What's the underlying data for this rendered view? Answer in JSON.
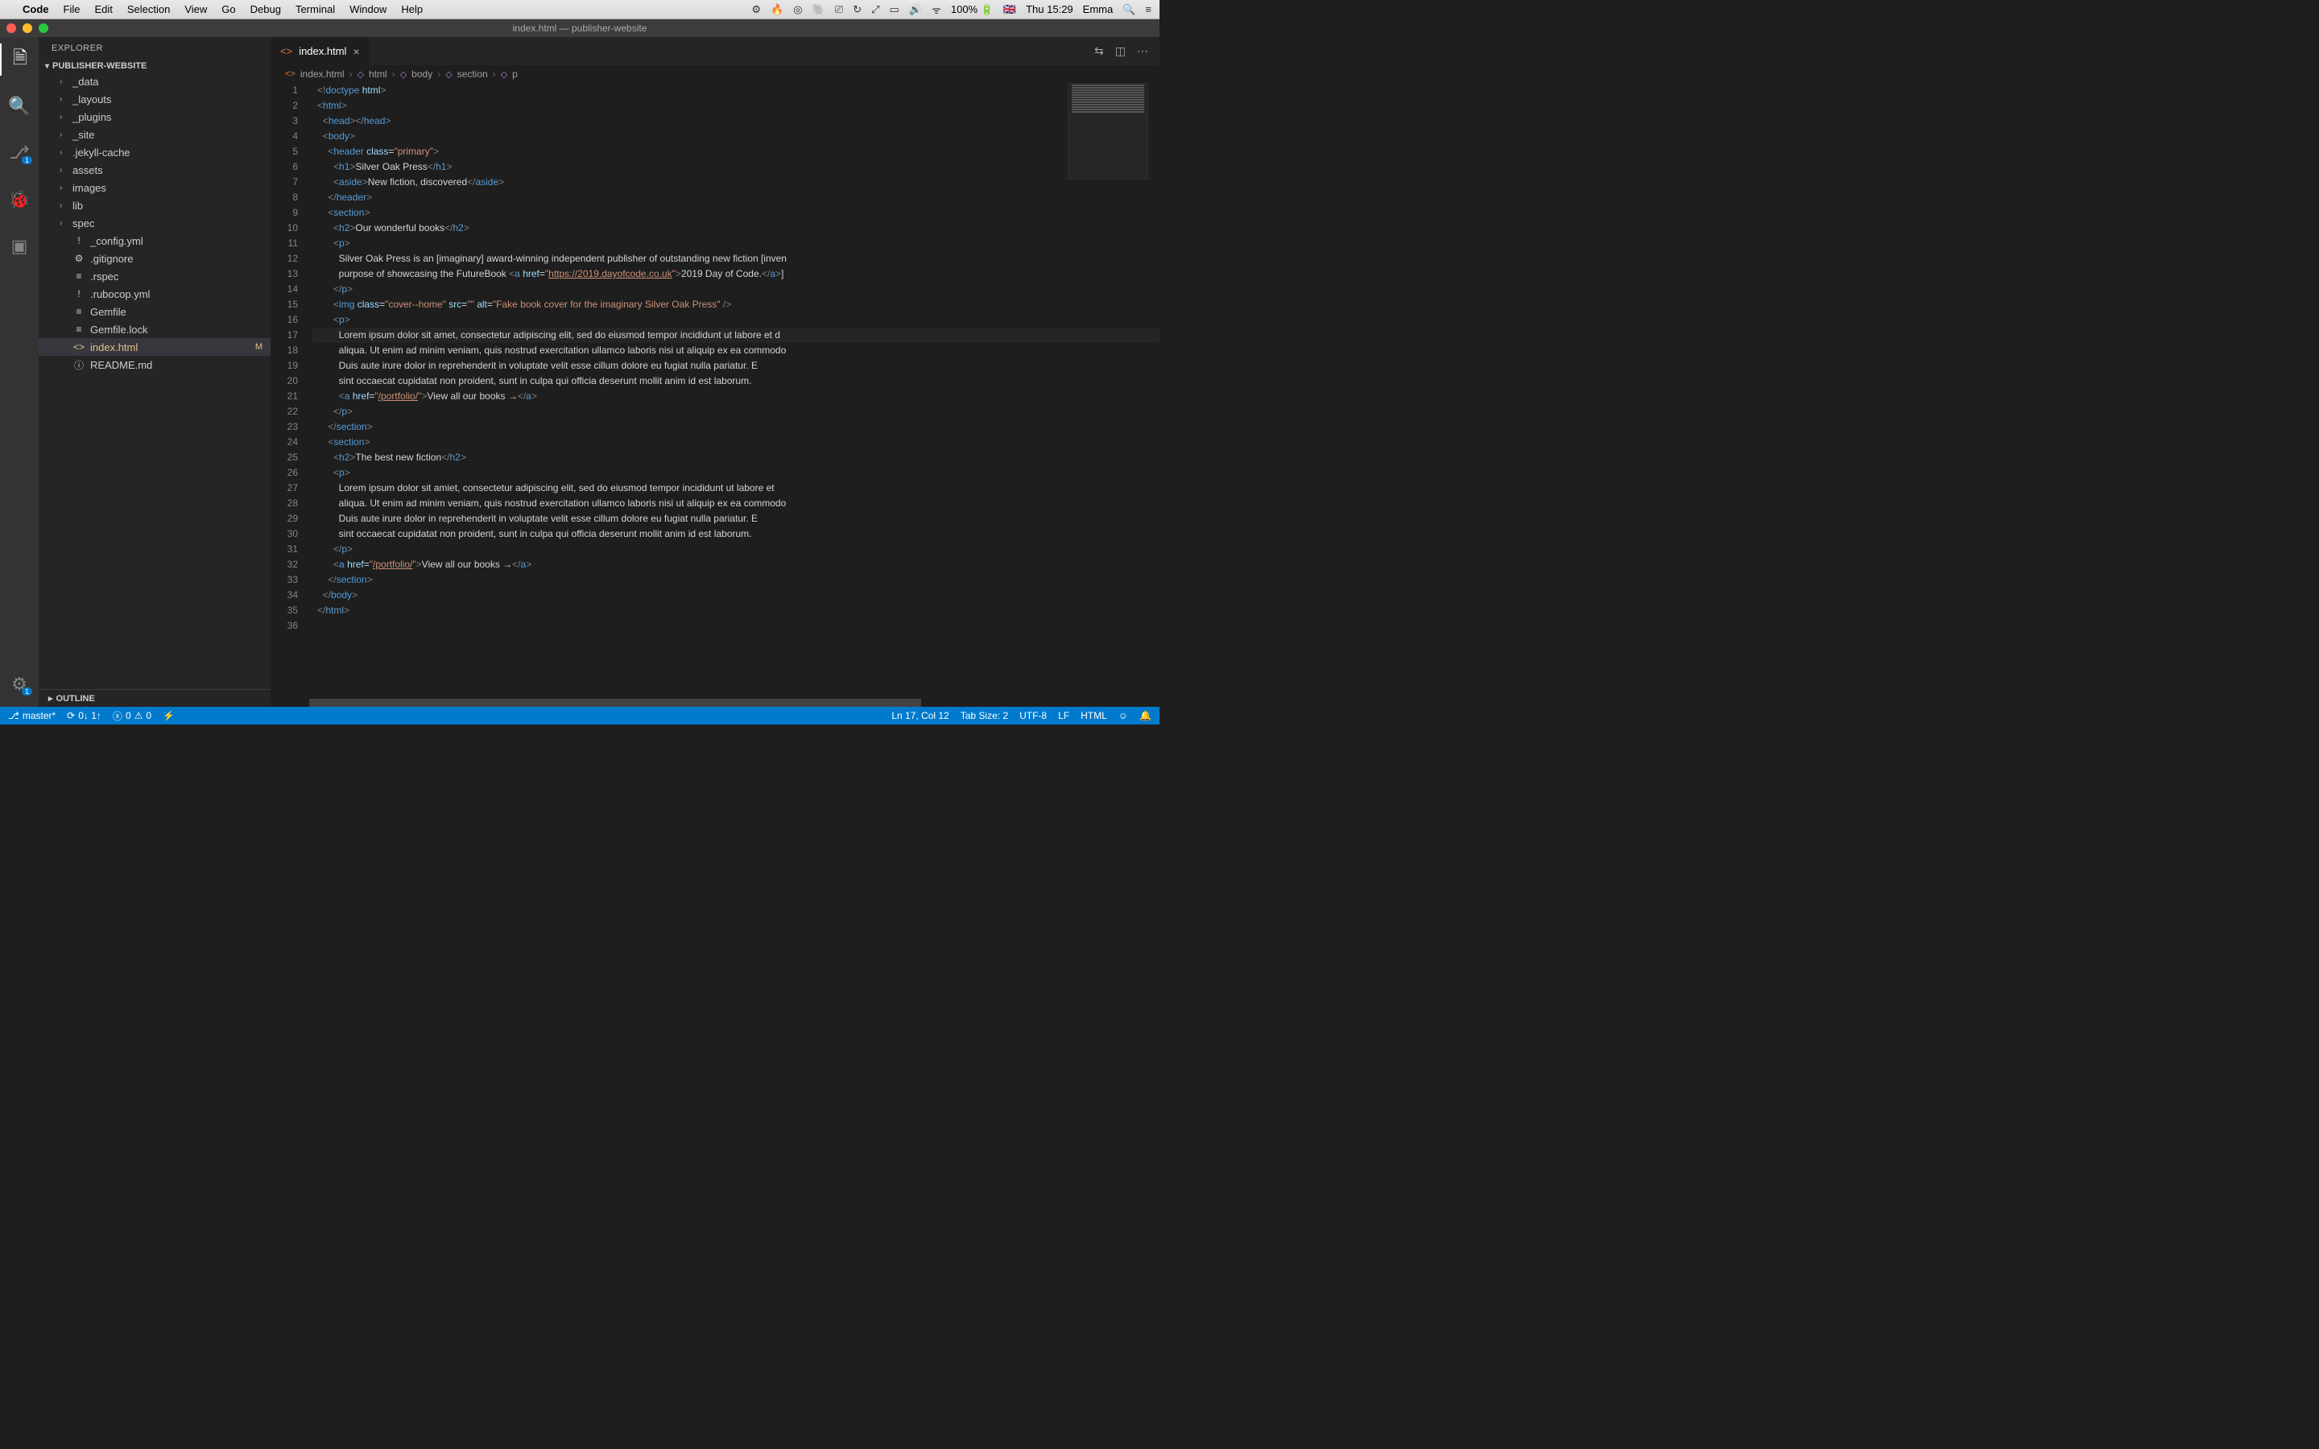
{
  "menubar": {
    "app": "Code",
    "items": [
      "File",
      "Edit",
      "Selection",
      "View",
      "Go",
      "Debug",
      "Terminal",
      "Window",
      "Help"
    ],
    "battery": "100%",
    "clock": "Thu 15:29",
    "user": "Emma"
  },
  "window": {
    "title": "index.html — publisher-website"
  },
  "activity": {
    "badge_scm": "1",
    "badge_settings": "1"
  },
  "sidebar": {
    "title": "EXPLORER",
    "section": "PUBLISHER-WEBSITE",
    "outline": "OUTLINE",
    "items": [
      {
        "name": "_data",
        "type": "folder"
      },
      {
        "name": "_layouts",
        "type": "folder"
      },
      {
        "name": "_plugins",
        "type": "folder"
      },
      {
        "name": "_site",
        "type": "folder"
      },
      {
        "name": ".jekyll-cache",
        "type": "folder"
      },
      {
        "name": "assets",
        "type": "folder"
      },
      {
        "name": "images",
        "type": "folder"
      },
      {
        "name": "lib",
        "type": "folder"
      },
      {
        "name": "spec",
        "type": "folder"
      },
      {
        "name": "_config.yml",
        "type": "file",
        "icon": "!",
        "class": ""
      },
      {
        "name": ".gitignore",
        "type": "file",
        "icon": "⚙",
        "class": ""
      },
      {
        "name": ".rspec",
        "type": "file",
        "icon": "≡",
        "class": ""
      },
      {
        "name": ".rubocop.yml",
        "type": "file",
        "icon": "!",
        "class": ""
      },
      {
        "name": "Gemfile",
        "type": "file",
        "icon": "≡",
        "class": ""
      },
      {
        "name": "Gemfile.lock",
        "type": "file",
        "icon": "≡",
        "class": ""
      },
      {
        "name": "index.html",
        "type": "file",
        "icon": "<>",
        "class": "modified selected",
        "status": "M"
      },
      {
        "name": "README.md",
        "type": "file",
        "icon": "ⓘ",
        "class": ""
      }
    ]
  },
  "tabs": {
    "open": [
      {
        "label": "index.html",
        "icon": "<>"
      }
    ]
  },
  "breadcrumb": [
    "index.html",
    "html",
    "body",
    "section",
    "p"
  ],
  "statusbar": {
    "branch": "master*",
    "sync": "0↓ 1↑",
    "errors": "0",
    "warnings": "0",
    "cursor": "Ln 17, Col 12",
    "indent": "Tab Size: 2",
    "encoding": "UTF-8",
    "eol": "LF",
    "lang": "HTML"
  },
  "code": {
    "lines": [
      {
        "n": 1,
        "mod": "",
        "html": "<span class='c-br'>&lt;!</span><span class='c-doc'>doctype</span> <span class='c-attr'>html</span><span class='c-br'>&gt;</span>"
      },
      {
        "n": 2,
        "mod": "",
        "html": "<span class='c-br'>&lt;</span><span class='c-tag'>html</span><span class='c-br'>&gt;</span>"
      },
      {
        "n": 3,
        "mod": "",
        "html": "  <span class='c-br'>&lt;</span><span class='c-tag'>head</span><span class='c-br'>&gt;&lt;/</span><span class='c-tag'>head</span><span class='c-br'>&gt;</span>"
      },
      {
        "n": 4,
        "mod": "",
        "html": "  <span class='c-br'>&lt;</span><span class='c-tag'>body</span><span class='c-br'>&gt;</span>"
      },
      {
        "n": 5,
        "mod": "b",
        "html": "    <span class='c-br'>&lt;</span><span class='c-tag'>header</span> <span class='c-attr'>class</span>=<span class='c-str'>\"primary\"</span><span class='c-br'>&gt;</span>"
      },
      {
        "n": 6,
        "mod": "b",
        "html": "      <span class='c-br'>&lt;</span><span class='c-tag'>h1</span><span class='c-br'>&gt;</span>Silver Oak Press<span class='c-br'>&lt;/</span><span class='c-tag'>h1</span><span class='c-br'>&gt;</span>"
      },
      {
        "n": 7,
        "mod": "b",
        "html": "      <span class='c-br'>&lt;</span><span class='c-tag'>aside</span><span class='c-br'>&gt;</span>New fiction, discovered<span class='c-br'>&lt;/</span><span class='c-tag'>aside</span><span class='c-br'>&gt;</span>"
      },
      {
        "n": 8,
        "mod": "b",
        "html": "    <span class='c-br'>&lt;/</span><span class='c-tag'>header</span><span class='c-br'>&gt;</span>"
      },
      {
        "n": 9,
        "mod": "b",
        "html": "    <span class='c-br'>&lt;</span><span class='c-tag'>section</span><span class='c-br'>&gt;</span>"
      },
      {
        "n": 10,
        "mod": "b",
        "html": "      <span class='c-br'>&lt;</span><span class='c-tag'>h2</span><span class='c-br'>&gt;</span>Our wonderful books<span class='c-br'>&lt;/</span><span class='c-tag'>h2</span><span class='c-br'>&gt;</span>"
      },
      {
        "n": 11,
        "mod": "b",
        "html": "      <span class='c-br'>&lt;</span><span class='c-tag'>p</span><span class='c-br'>&gt;</span>"
      },
      {
        "n": 12,
        "mod": "b",
        "html": "        Silver Oak Press is an [imaginary] award-winning independent publisher of outstanding new fiction [inven"
      },
      {
        "n": 13,
        "mod": "b",
        "html": "        purpose of showcasing the FutureBook <span class='c-br'>&lt;</span><span class='c-tag'>a</span> <span class='c-attr'>href</span>=<span class='c-str'>\"</span><span class='c-link'>https://2019.dayofcode.co.uk</span><span class='c-str'>\"</span><span class='c-br'>&gt;</span>2019 Day of Code.<span class='c-br'>&lt;/</span><span class='c-tag'>a</span><span class='c-br'>&gt;</span>]"
      },
      {
        "n": 14,
        "mod": "b",
        "html": "      <span class='c-br'>&lt;/</span><span class='c-tag'>p</span><span class='c-br'>&gt;</span>"
      },
      {
        "n": 15,
        "mod": "b",
        "html": "      <span class='c-br'>&lt;</span><span class='c-tag'>img</span> <span class='c-attr'>class</span>=<span class='c-str'>\"cover--home\"</span> <span class='c-attr'>src</span>=<span class='c-str'>\"\"</span> <span class='c-attr'>alt</span>=<span class='c-str'>\"Fake book cover for the imaginary Silver Oak Press\"</span> <span class='c-br'>/&gt;</span>"
      },
      {
        "n": 16,
        "mod": "b",
        "html": "      <span class='c-br'>&lt;</span><span class='c-tag'>p</span><span class='c-br'>&gt;</span>"
      },
      {
        "n": 17,
        "mod": "b",
        "cursor": true,
        "html": "        Lorem ipsum dolor sit amet, consectetur adipiscing elit, sed do eiusmod tempor incididunt ut labore et d"
      },
      {
        "n": 18,
        "mod": "b",
        "html": "        aliqua. Ut enim ad minim veniam, quis nostrud exercitation ullamco laboris nisi ut aliquip ex ea commodo"
      },
      {
        "n": 19,
        "mod": "b",
        "html": "        Duis aute irure dolor in reprehenderit in voluptate velit esse cillum dolore eu fugiat nulla pariatur. E"
      },
      {
        "n": 20,
        "mod": "b",
        "html": "        sint occaecat cupidatat non proident, sunt in culpa qui officia deserunt mollit anim id est laborum."
      },
      {
        "n": 21,
        "mod": "b",
        "html": "        <span class='c-br'>&lt;</span><span class='c-tag'>a</span> <span class='c-attr'>href</span>=<span class='c-str'>\"</span><span class='c-link'>/portfolio/</span><span class='c-str'>\"</span><span class='c-br'>&gt;</span>View all our books →<span class='c-br'>&lt;/</span><span class='c-tag'>a</span><span class='c-br'>&gt;</span>"
      },
      {
        "n": 22,
        "mod": "b",
        "html": "      <span class='c-br'>&lt;/</span><span class='c-tag'>p</span><span class='c-br'>&gt;</span>"
      },
      {
        "n": 23,
        "mod": "b",
        "html": "    <span class='c-br'>&lt;/</span><span class='c-tag'>section</span><span class='c-br'>&gt;</span>"
      },
      {
        "n": 24,
        "mod": "b",
        "html": "    <span class='c-br'>&lt;</span><span class='c-tag'>section</span><span class='c-br'>&gt;</span>"
      },
      {
        "n": 25,
        "mod": "b",
        "html": "      <span class='c-br'>&lt;</span><span class='c-tag'>h2</span><span class='c-br'>&gt;</span>The best new fiction<span class='c-br'>&lt;/</span><span class='c-tag'>h2</span><span class='c-br'>&gt;</span>"
      },
      {
        "n": 26,
        "mod": "b",
        "html": "      <span class='c-br'>&lt;</span><span class='c-tag'>p</span><span class='c-br'>&gt;</span>"
      },
      {
        "n": 27,
        "mod": "b",
        "html": "        Lorem ipsum dolor sit amiet, consectetur adipiscing elit, sed do eiusmod tempor incididunt ut labore et "
      },
      {
        "n": 28,
        "mod": "b",
        "html": "        aliqua. Ut enim ad minim veniam, quis nostrud exercitation ullamco laboris nisi ut aliquip ex ea commodo"
      },
      {
        "n": 29,
        "mod": "b",
        "html": "        Duis aute irure dolor in reprehenderit in voluptate velit esse cillum dolore eu fugiat nulla pariatur. E"
      },
      {
        "n": 30,
        "mod": "b",
        "html": "        sint occaecat cupidatat non proident, sunt in culpa qui officia deserunt mollit anim id est laborum."
      },
      {
        "n": 31,
        "mod": "b",
        "html": "      <span class='c-br'>&lt;/</span><span class='c-tag'>p</span><span class='c-br'>&gt;</span>"
      },
      {
        "n": 32,
        "mod": "b",
        "html": "      <span class='c-br'>&lt;</span><span class='c-tag'>a</span> <span class='c-attr'>href</span>=<span class='c-str'>\"</span><span class='c-link'>/portfolio/</span><span class='c-str'>\"</span><span class='c-br'>&gt;</span>View all our books →<span class='c-br'>&lt;/</span><span class='c-tag'>a</span><span class='c-br'>&gt;</span>"
      },
      {
        "n": 33,
        "mod": "b",
        "html": "    <span class='c-br'>&lt;/</span><span class='c-tag'>section</span><span class='c-br'>&gt;</span>"
      },
      {
        "n": 34,
        "mod": "",
        "html": "  <span class='c-br'>&lt;/</span><span class='c-tag'>body</span><span class='c-br'>&gt;</span>"
      },
      {
        "n": 35,
        "mod": "",
        "html": "<span class='c-br'>&lt;/</span><span class='c-tag'>html</span><span class='c-br'>&gt;</span>"
      },
      {
        "n": 36,
        "mod": "",
        "html": ""
      }
    ]
  }
}
